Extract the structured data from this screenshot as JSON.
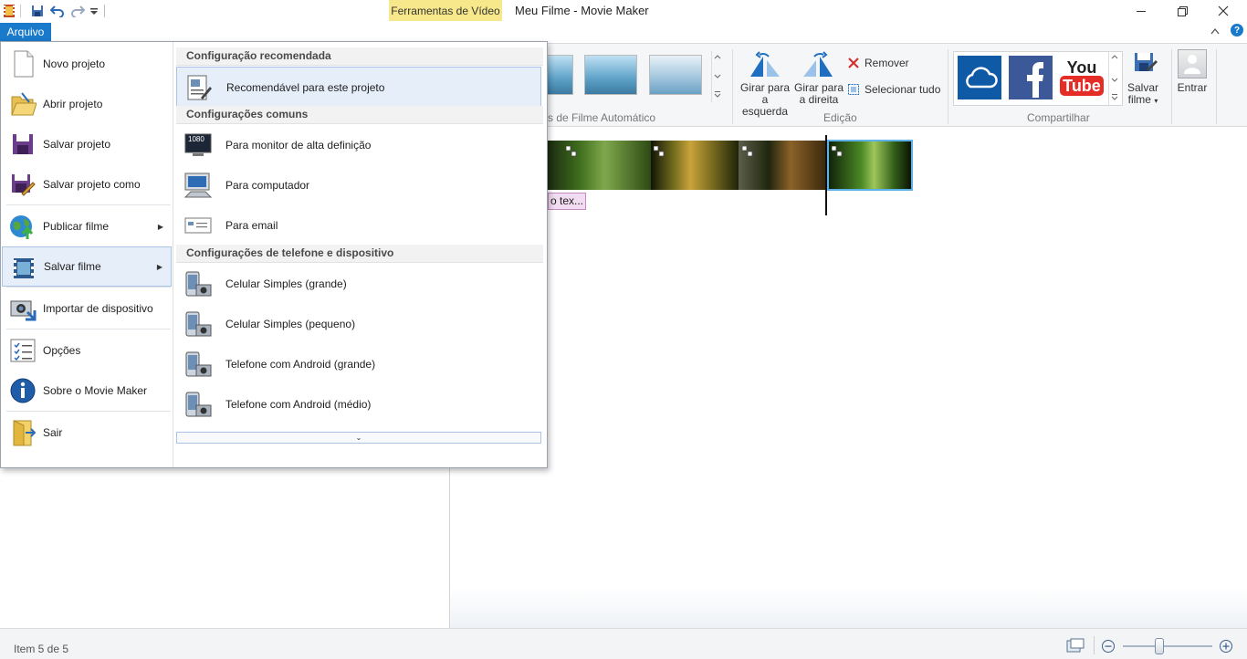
{
  "titlebar": {
    "tools_tab": "Ferramentas de Vídeo",
    "title": "Meu Filme - Movie Maker"
  },
  "ribbon": {
    "file_tab": "Arquivo",
    "groups": {
      "themes_label": "s de Filme Automático",
      "edit_label": "Edição",
      "share_label": "Compartilhar"
    },
    "rotate_left": [
      "Girar para",
      "a esquerda"
    ],
    "rotate_right": [
      "Girar para",
      "a direita"
    ],
    "remove": "Remover",
    "select_all": "Selecionar tudo",
    "save_movie": [
      "Salvar",
      "filme"
    ],
    "sign_in": "Entrar",
    "share_tiles": [
      {
        "name": "onedrive",
        "color": "#0e5aa7"
      },
      {
        "name": "facebook",
        "color": "#3b5998"
      },
      {
        "name": "youtube",
        "color": "#e52d27",
        "text_top": "You",
        "text_bottom": "Tube"
      }
    ]
  },
  "file_menu": {
    "left_items": [
      {
        "label": "Novo projeto",
        "icon": "new-project-icon"
      },
      {
        "label": "Abrir projeto",
        "icon": "open-project-icon"
      },
      {
        "label": "Salvar projeto",
        "icon": "save-project-icon"
      },
      {
        "label": "Salvar projeto como",
        "icon": "save-as-icon"
      },
      {
        "label": "Publicar filme",
        "icon": "publish-globe-icon",
        "submenu": true
      },
      {
        "label": "Salvar filme",
        "icon": "save-movie-icon",
        "submenu": true,
        "active": true
      },
      {
        "label": "Importar de dispositivo",
        "icon": "import-camera-icon"
      },
      {
        "label": "Opções",
        "icon": "options-list-icon"
      },
      {
        "label": "Sobre o Movie Maker",
        "icon": "info-icon"
      },
      {
        "label": "Sair",
        "icon": "exit-icon"
      }
    ],
    "sections": {
      "recommended": "Configuração recomendada",
      "common": "Configurações comuns",
      "phone": "Configurações de telefone e dispositivo"
    },
    "right_items": {
      "recommended": "Recomendável para este projeto",
      "hd_monitor": "Para monitor de alta definição",
      "hd_badge": "1080",
      "computer": "Para computador",
      "email": "Para email",
      "phone_large": "Celular Simples (grande)",
      "phone_small": "Celular Simples (pequeno)",
      "android_large": "Telefone com Android (grande)",
      "android_medium": "Telefone com Android (médio)"
    },
    "more_glyph": "⌄"
  },
  "storyboard": {
    "caption_text": "o tex..."
  },
  "statusbar": {
    "text": "Item 5 de 5"
  }
}
